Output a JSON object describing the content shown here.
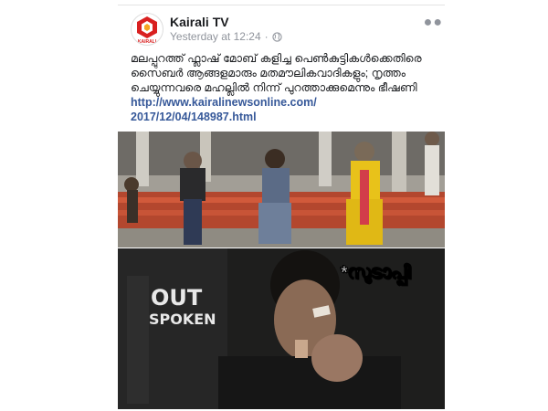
{
  "post": {
    "page_name": "Kairali TV",
    "timestamp": "Yesterday at 12:24",
    "separator": "·",
    "audience_icon": "globe-icon",
    "more_icon": "more-options-icon",
    "body_text": "മലപ്പുറത്ത് ഫ്ലാഷ് മോബ് കളിച്ച പെൺകുട്ടികൾക്കെതിരെ സൈബർ ആങ്ങളമാരും മതമൗലികവാദികളും; നൃത്തം ചെയ്യുന്നവരെ മഹല്ലിൽ നിന്ന് പുറത്താക്കുമെന്നും ഭീഷണി",
    "link_line1": "http://www.kairalinewsonline.com/",
    "link_line2": "2017/12/04/148987.html"
  },
  "avatar": {
    "logo_text": "KAIRALI"
  },
  "meme": {
    "caption": "*സുടാപ്പി",
    "logo_word1": "OUT",
    "logo_word2": "SPOKEN"
  },
  "colors": {
    "link": "#365899",
    "meta": "#90949c",
    "logo_red": "#d92020",
    "saree_yellow": "#e8c21a"
  }
}
